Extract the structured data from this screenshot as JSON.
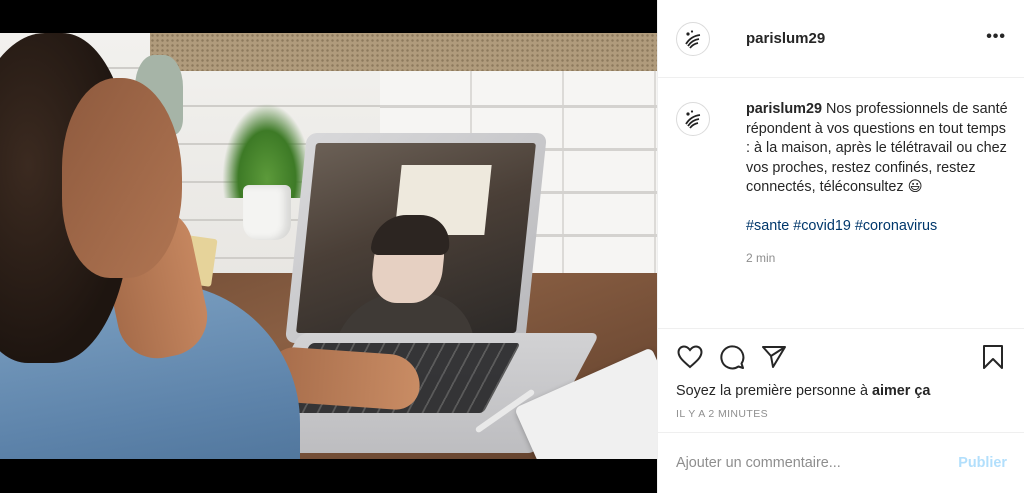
{
  "post": {
    "username": "parislum29",
    "more_label": "•••",
    "caption_user": "parislum29",
    "caption_text": " Nos professionnels de santé répondent à vos questions en tout temps : à la maison, après le télétravail ou chez vos proches, restez confinés, restez connectés, téléconsultez 😃",
    "hashtags": [
      "#sante",
      "#covid19",
      "#coronavirus"
    ],
    "caption_time": "2 min",
    "likes_prefix": "Soyez la première personne à ",
    "likes_action": "aimer ça",
    "post_time": "IL Y A 2 MINUTES"
  },
  "comment": {
    "placeholder": "Ajouter un commentaire...",
    "publish_label": "Publier"
  },
  "icons": {
    "avatar": "logo-icon",
    "like": "heart-icon",
    "comment": "comment-icon",
    "share": "share-icon",
    "save": "bookmark-icon"
  },
  "colors": {
    "hashtag": "#00376b",
    "publish_disabled": "#b2dffc",
    "muted": "#8e8e8e"
  }
}
